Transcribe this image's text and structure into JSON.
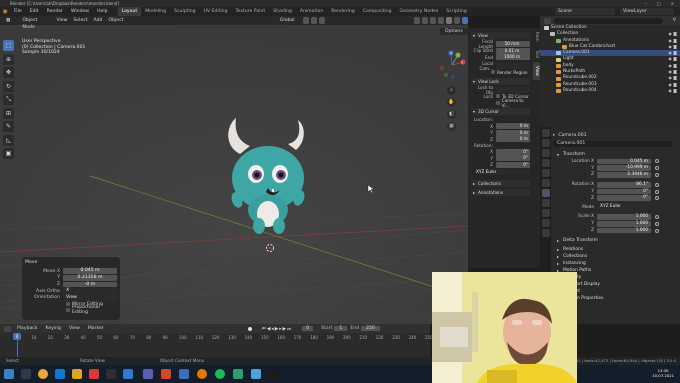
{
  "window": {
    "title": "Blender [C:\\Users\\ah\\Dropbox\\Renders\\monster.blend]",
    "controls": [
      "–",
      "□",
      "✕"
    ]
  },
  "menubar": {
    "menus": [
      "File",
      "Edit",
      "Render",
      "Window",
      "Help"
    ],
    "workspaces": [
      "Layout",
      "Modeling",
      "Sculpting",
      "UV Editing",
      "Texture Paint",
      "Shading",
      "Animation",
      "Rendering",
      "Compositing",
      "Geometry Nodes",
      "Scripting"
    ],
    "active_workspace": "Layout",
    "scene": "Scene",
    "view_layer": "ViewLayer"
  },
  "viewport": {
    "mode": "Object Mode",
    "menus": [
      "View",
      "Select",
      "Add",
      "Object"
    ],
    "transform_orientation": "Global",
    "options_label": "Options",
    "info_lines": [
      "User Perspective",
      "(0) Collection | Camera.001",
      "Sample 30/1024"
    ],
    "gizmo": {
      "x": "X",
      "y": "Y",
      "z": "Z"
    }
  },
  "toolbar": {
    "tools": [
      "select-box",
      "cursor",
      "move",
      "rotate",
      "scale",
      "transform",
      "annotate",
      "measure",
      "add-cube"
    ]
  },
  "redo_panel": {
    "title": "Move",
    "fields": [
      {
        "label": "Move X",
        "value": "0.045 m"
      },
      {
        "label": "Y",
        "value": "0.21358 m"
      },
      {
        "label": "Z",
        "value": "-0 m"
      },
      {
        "label": "Axis Ortho",
        "value": "X"
      },
      {
        "label": "Orientation",
        "value": "View"
      }
    ],
    "checks": [
      "Mirror Editing",
      "Proportional Editing"
    ]
  },
  "npanel": {
    "tabs": [
      "Item",
      "Tool",
      "View"
    ],
    "active_tab": "View",
    "view_section": "View",
    "focal_length_label": "Focal Length",
    "focal_length": "50 mm",
    "clip_start_label": "Clip Start",
    "clip_start": "0.01 m",
    "clip_end_label": "End",
    "clip_end": "1000 m",
    "local_camera_label": "Local Cam...",
    "render_region_label": "Render Region",
    "view_lock_section": "View Lock",
    "lock_to_object_label": "Lock to Obj",
    "lock_label": "Lock",
    "lock_opts": [
      "To 3D Cursor",
      "Camera to Vi..."
    ],
    "cursor_section": "3D Cursor",
    "location_label": "Location:",
    "cursor_loc": [
      {
        "label": "X",
        "value": "0 m"
      },
      {
        "label": "Y",
        "value": "0 m"
      },
      {
        "label": "Z",
        "value": "0 m"
      }
    ],
    "rotation_label": "Rotation:",
    "cursor_rot": [
      {
        "label": "X",
        "value": "0°"
      },
      {
        "label": "Y",
        "value": "0°"
      },
      {
        "label": "Z",
        "value": "0°"
      }
    ],
    "rotation_mode": "XYZ Euler",
    "collections_section": "Collections",
    "annotations_section": "Annotations"
  },
  "outliner": {
    "title": "Scene Collection",
    "items": [
      {
        "label": "Collection",
        "indent": 1,
        "color": "#bdbdbd",
        "selected": false
      },
      {
        "label": "Annotations",
        "indent": 2,
        "color": "#7fb36a",
        "selected": false
      },
      {
        "label": "Blue Cat Cambrichart",
        "indent": 3,
        "color": "#e09a3c",
        "selected": false
      },
      {
        "label": "Camera.001",
        "indent": 2,
        "color": "#9ac9e0",
        "selected": true
      },
      {
        "label": "Light",
        "indent": 2,
        "color": "#e0d07a",
        "selected": false
      },
      {
        "label": "body",
        "indent": 2,
        "color": "#e09a3c",
        "selected": false
      },
      {
        "label": "NurbsPath",
        "indent": 2,
        "color": "#e09a3c",
        "selected": false
      },
      {
        "label": "Roundcube.002",
        "indent": 2,
        "color": "#e09a3c",
        "selected": false
      },
      {
        "label": "Roundcube.003",
        "indent": 2,
        "color": "#e09a3c",
        "selected": false
      },
      {
        "label": "Roundcube.004",
        "indent": 2,
        "color": "#e09a3c",
        "selected": false
      }
    ]
  },
  "properties": {
    "breadcrumb": "Camera.001",
    "object_name": "Camera.001",
    "transform_section": "Transform",
    "location_label": "Location X",
    "location": [
      {
        "label": "Location X",
        "value": "0.045 m"
      },
      {
        "label": "Y",
        "value": "-10.999 m"
      },
      {
        "label": "Z",
        "value": "2.3946 m"
      }
    ],
    "rotation": [
      {
        "label": "Rotation X",
        "value": "86.1°"
      },
      {
        "label": "Y",
        "value": "0°"
      },
      {
        "label": "Z",
        "value": "0°"
      }
    ],
    "mode_label": "Mode",
    "mode_value": "XYZ Euler",
    "scale": [
      {
        "label": "Scale X",
        "value": "1.000"
      },
      {
        "label": "Y",
        "value": "1.000"
      },
      {
        "label": "Z",
        "value": "1.000"
      }
    ],
    "delta_section": "Delta Transform",
    "relations_section": "Relations",
    "more_sections": [
      "Collections",
      "Instancing",
      "Motion Paths",
      "Visibility",
      "Viewport Display",
      "Line Art",
      "Custom Properties"
    ]
  },
  "timeline": {
    "menus": [
      "Playback",
      "Keying",
      "View",
      "Marker"
    ],
    "current_frame": "0",
    "start_label": "Start",
    "start": "1",
    "end_label": "End",
    "end": "250",
    "ruler_numbers": [
      "0",
      "10",
      "20",
      "30",
      "40",
      "50",
      "60",
      "70",
      "80",
      "90",
      "100",
      "110",
      "120",
      "130",
      "140",
      "150",
      "160",
      "170",
      "180",
      "190",
      "200",
      "210",
      "220",
      "230",
      "240",
      "250"
    ]
  },
  "statusbar": {
    "left": "Select",
    "middle1": "Rotate View",
    "middle2": "Object Context Menu",
    "right": "Collection | Camera.001 | Verts:42,472 | Faces:84,944 | Objects:1/9 | 3.0.0"
  },
  "taskbar": {
    "time": "13:30",
    "date": "10.07.2021"
  },
  "colors": {
    "accent": "#4772b3",
    "monster_body": "#3ea7a6",
    "horn": "#e6e2dd",
    "belly": "#ecebe8"
  }
}
